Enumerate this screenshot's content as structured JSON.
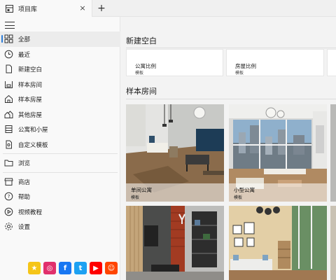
{
  "tab": {
    "icon": "library-icon",
    "label": "项目库",
    "close": "×",
    "new_tab": "+"
  },
  "sidebar": {
    "items": [
      {
        "label": "全部",
        "icon": "grid-icon",
        "active": true
      },
      {
        "label": "最近",
        "icon": "clock-icon"
      },
      {
        "label": "新建空白",
        "icon": "document-icon"
      },
      {
        "label": "样本房间",
        "icon": "room-icon"
      },
      {
        "label": "样本房屋",
        "icon": "house-icon"
      },
      {
        "label": "其他房屋",
        "icon": "houses-icon"
      },
      {
        "label": "公寓和小屋",
        "icon": "apartment-icon"
      },
      {
        "label": "自定义模板",
        "icon": "template-icon"
      },
      {
        "label": "浏览",
        "icon": "folder-icon"
      },
      {
        "label": "商店",
        "icon": "store-icon"
      },
      {
        "label": "帮助",
        "icon": "help-icon"
      },
      {
        "label": "视频教程",
        "icon": "play-icon"
      },
      {
        "label": "设置",
        "icon": "gear-icon"
      }
    ],
    "social": [
      {
        "name": "star-icon",
        "glyph": "★",
        "color": "#f5c518"
      },
      {
        "name": "instagram-icon",
        "glyph": "◎",
        "color": "#e1306c"
      },
      {
        "name": "facebook-icon",
        "glyph": "f",
        "color": "#1877f2"
      },
      {
        "name": "twitter-icon",
        "glyph": "t",
        "color": "#1da1f2"
      },
      {
        "name": "youtube-icon",
        "glyph": "▶",
        "color": "#ff0000"
      },
      {
        "name": "reddit-icon",
        "glyph": "☺",
        "color": "#ff4500"
      }
    ]
  },
  "main": {
    "new_blank": {
      "title": "新建空白",
      "items": [
        {
          "title": "公寓比例",
          "subtitle": "模板"
        },
        {
          "title": "房屋比例",
          "subtitle": "模板"
        }
      ]
    },
    "sample_rooms": {
      "title": "样本房间",
      "cards": [
        {
          "title": "单间公寓",
          "subtitle": "模板"
        },
        {
          "title": "小型公寓",
          "subtitle": "模板"
        },
        {
          "title": "",
          "subtitle": ""
        },
        {
          "title": "",
          "subtitle": ""
        }
      ]
    }
  }
}
